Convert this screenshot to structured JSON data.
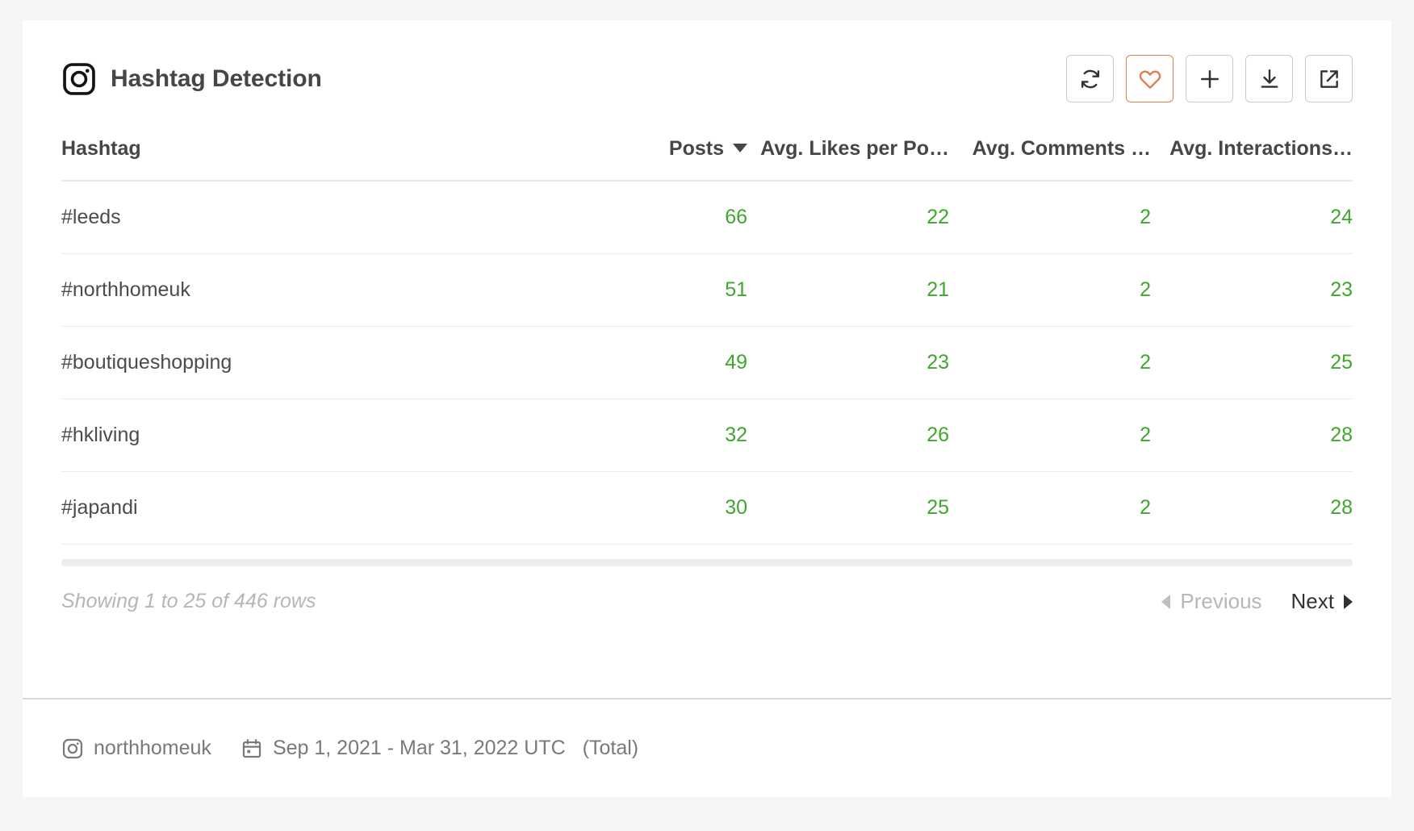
{
  "header": {
    "title": "Hashtag Detection",
    "network_icon": "instagram-icon",
    "toolbar": [
      {
        "name": "refresh-button",
        "icon": "refresh-icon",
        "active": false
      },
      {
        "name": "favorite-button",
        "icon": "heart-icon",
        "active": true
      },
      {
        "name": "add-button",
        "icon": "plus-icon",
        "active": false
      },
      {
        "name": "download-button",
        "icon": "download-icon",
        "active": false
      },
      {
        "name": "open-external-button",
        "icon": "external-link-icon",
        "active": false
      }
    ]
  },
  "table": {
    "columns": [
      {
        "label": "Hashtag",
        "align": "left",
        "sorted": false
      },
      {
        "label": "Posts",
        "align": "right",
        "sorted": true,
        "sort_direction": "desc"
      },
      {
        "label": "Avg. Likes per Po…",
        "align": "right",
        "sorted": false
      },
      {
        "label": "Avg. Comments …",
        "align": "right",
        "sorted": false
      },
      {
        "label": "Avg. Interactions…",
        "align": "right",
        "sorted": false
      }
    ],
    "rows": [
      {
        "hashtag": "#leeds",
        "posts": "66",
        "avg_likes": "22",
        "avg_comments": "2",
        "avg_interactions": "24"
      },
      {
        "hashtag": "#northhomeuk",
        "posts": "51",
        "avg_likes": "21",
        "avg_comments": "2",
        "avg_interactions": "23"
      },
      {
        "hashtag": "#boutiqueshopping",
        "posts": "49",
        "avg_likes": "23",
        "avg_comments": "2",
        "avg_interactions": "25"
      },
      {
        "hashtag": "#hkliving",
        "posts": "32",
        "avg_likes": "26",
        "avg_comments": "2",
        "avg_interactions": "28"
      },
      {
        "hashtag": "#japandi",
        "posts": "30",
        "avg_likes": "25",
        "avg_comments": "2",
        "avg_interactions": "28"
      }
    ]
  },
  "pagination": {
    "showing": "Showing 1 to 25 of 446 rows",
    "previous_label": "Previous",
    "next_label": "Next",
    "previous_enabled": false,
    "next_enabled": true
  },
  "footer": {
    "profile_icon": "instagram-icon",
    "profile": "northhomeuk",
    "date_icon": "calendar-icon",
    "date_range": "Sep 1, 2021 - Mar 31, 2022 UTC",
    "aggregation": "(Total)"
  },
  "colors": {
    "page_background": "#f4f5f7",
    "card_background": "#ffffff",
    "metric_green": "#3fa72c",
    "accent_orange": "#df7f51",
    "text_dark": "#444648",
    "text_muted": "#78797b",
    "text_disabled": "#b4b6b8",
    "border": "#e8e9ea"
  }
}
